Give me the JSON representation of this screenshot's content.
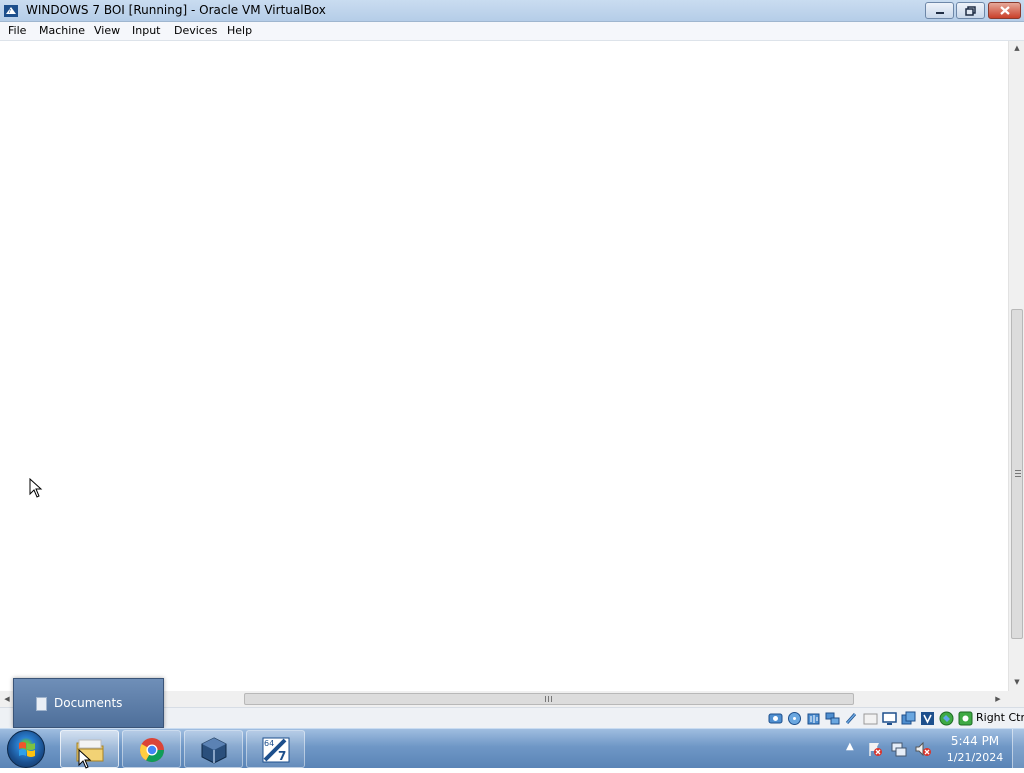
{
  "window": {
    "title": "WINDOWS 7 BOI [Running] - Oracle VM VirtualBox",
    "buttons": [
      "minimize",
      "maximize",
      "close"
    ]
  },
  "menu": {
    "items": [
      "File",
      "Machine",
      "View",
      "Input",
      "Devices",
      "Help"
    ]
  },
  "statusbar": {
    "host_key": "Right Ctrl",
    "icons": [
      "hard-disk-icon",
      "optical-drive-icon",
      "audio-icon",
      "network-icon",
      "usb-icon",
      "shared-folders-icon",
      "display-icon",
      "recording-icon",
      "vm-window-icon",
      "cpu-icon",
      "mouse-integration-icon",
      "keyboard-icon"
    ]
  },
  "jumplist": {
    "label": "Documents"
  },
  "taskbar": {
    "pinned": [
      "windows-explorer",
      "google-chrome",
      "oracle-vm-virtualbox",
      "windows-7-64bit-vm"
    ],
    "active": "windows-explorer"
  },
  "clock": {
    "time": "5:44 PM",
    "date": "1/21/2024"
  },
  "colors": {
    "titlebar": "#c9dcf0",
    "taskbar": "#6f97c6",
    "popup": "#5a7aa6"
  }
}
